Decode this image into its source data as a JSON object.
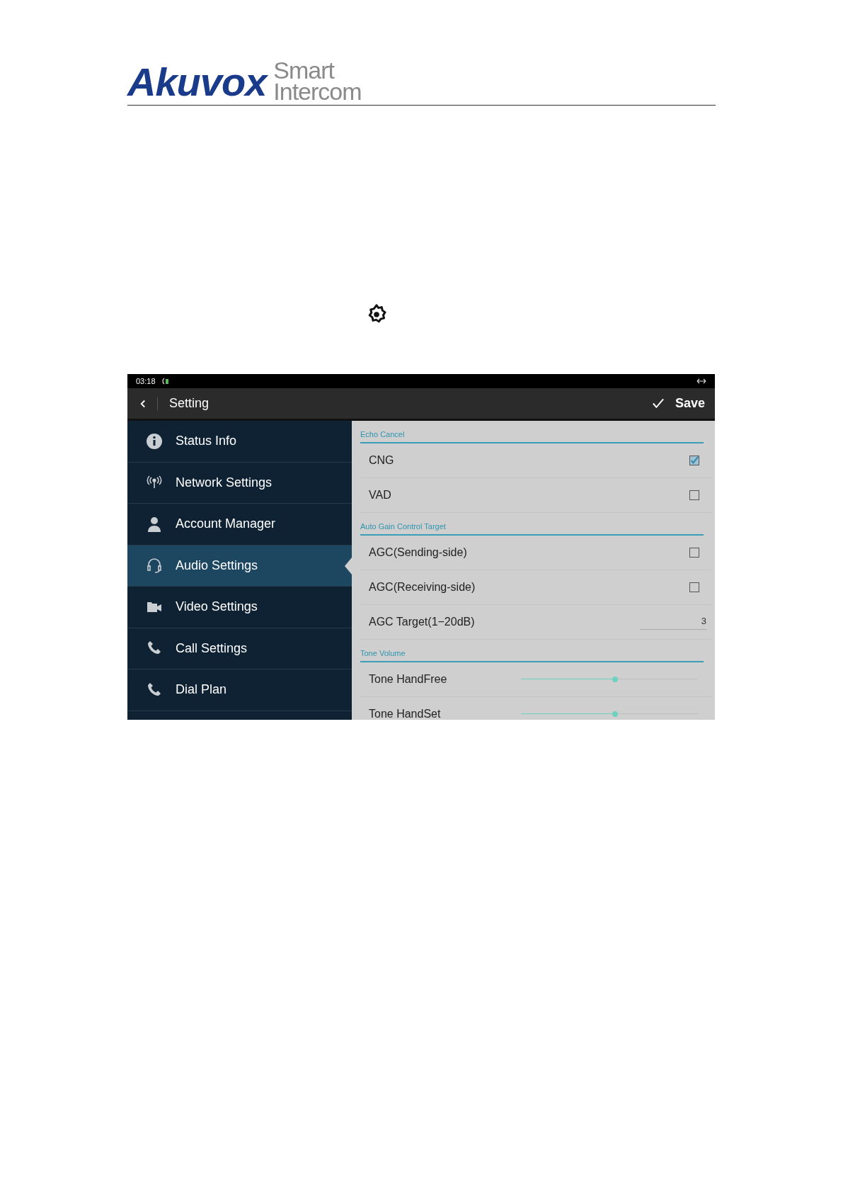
{
  "header": {
    "brand": "Akuvox",
    "tagline_top": "Smart",
    "tagline_bottom": "Intercom"
  },
  "screen": {
    "status_bar": {
      "time": "03:18"
    },
    "title_bar": {
      "title": "Setting",
      "save": "Save"
    },
    "sidebar": {
      "items": [
        {
          "label": "Status Info",
          "selected": false
        },
        {
          "label": "Network Settings",
          "selected": false
        },
        {
          "label": "Account Manager",
          "selected": false
        },
        {
          "label": "Audio Settings",
          "selected": true
        },
        {
          "label": "Video Settings",
          "selected": false
        },
        {
          "label": "Call Settings",
          "selected": false
        },
        {
          "label": "Dial Plan",
          "selected": false
        }
      ]
    },
    "sections": [
      {
        "title": "Echo Cancel",
        "rows": [
          {
            "kind": "checkbox",
            "label": "CNG",
            "checked": true
          },
          {
            "kind": "checkbox",
            "label": "VAD",
            "checked": false
          }
        ]
      },
      {
        "title": "Auto Gain Control Target",
        "rows": [
          {
            "kind": "checkbox",
            "label": "AGC(Sending-side)",
            "checked": false
          },
          {
            "kind": "checkbox",
            "label": "AGC(Receiving-side)",
            "checked": false
          },
          {
            "kind": "value",
            "label": "AGC Target(1−20dB)",
            "value": "3"
          }
        ]
      },
      {
        "title": "Tone Volume",
        "rows": [
          {
            "kind": "slider",
            "label": "Tone HandFree",
            "level": 0.53
          },
          {
            "kind": "slider",
            "label": "Tone HandSet",
            "level": 0.53
          }
        ]
      }
    ]
  }
}
